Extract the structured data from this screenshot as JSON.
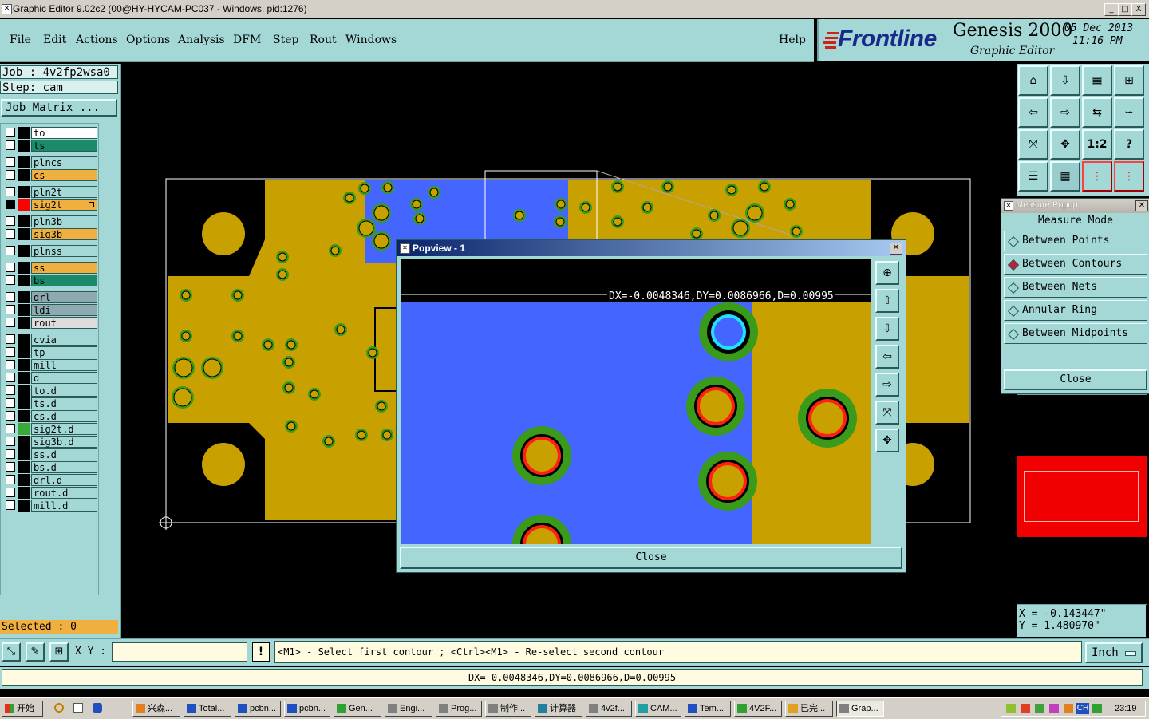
{
  "window": {
    "title": "Graphic Editor 9.02c2 (00@HY-HYCAM-PC037 - Windows, pid:1276)",
    "controls": [
      "_",
      "□",
      "X"
    ]
  },
  "menu": {
    "items": [
      "File",
      "Edit",
      "Actions",
      "Options",
      "Analysis",
      "DFM",
      "Step",
      "Rout",
      "Windows"
    ],
    "help": "Help"
  },
  "brand": {
    "logo": "Frontline",
    "product": "Genesis 2000",
    "subtitle": "Graphic Editor",
    "date": "05 Dec 2013",
    "time": "11:16 PM"
  },
  "job": {
    "job_label": "Job : 4v2fp2wsa0",
    "step_label": "Step: cam",
    "matrix_button": "Job Matrix ..."
  },
  "layers": [
    {
      "name": "to",
      "bg": "#ffffff",
      "swatch": "#000000"
    },
    {
      "name": "ts",
      "bg": "#1a8a6a",
      "swatch": "#000000"
    },
    {
      "name": "plncs",
      "bg": "#a4d8d6",
      "swatch": "#000000"
    },
    {
      "name": "cs",
      "bg": "#f0b040",
      "swatch": "#000000"
    },
    {
      "name": "pln2t",
      "bg": "#a4d8d6",
      "swatch": "#000000"
    },
    {
      "name": "sig2t",
      "bg": "#f0b040",
      "swatch": "#ff0000",
      "active": true
    },
    {
      "name": "pln3b",
      "bg": "#a4d8d6",
      "swatch": "#000000"
    },
    {
      "name": "sig3b",
      "bg": "#f0b040",
      "swatch": "#000000"
    },
    {
      "name": "plnss",
      "bg": "#a4d8d6",
      "swatch": "#000000"
    },
    {
      "name": "ss",
      "bg": "#f0b040",
      "swatch": "#000000"
    },
    {
      "name": "bs",
      "bg": "#1a8a6a",
      "swatch": "#000000"
    },
    {
      "name": "drl",
      "bg": "#8eaab0",
      "swatch": "#000000"
    },
    {
      "name": "ldi",
      "bg": "#8eaab0",
      "swatch": "#000000"
    },
    {
      "name": "rout",
      "bg": "#dcdcdc",
      "swatch": "#000000"
    },
    {
      "name": "cvia",
      "bg": "#a4d8d6",
      "swatch": "#000000"
    },
    {
      "name": "tp",
      "bg": "#a4d8d6",
      "swatch": "#000000"
    },
    {
      "name": "mill",
      "bg": "#a4d8d6",
      "swatch": "#000000"
    },
    {
      "name": "d",
      "bg": "#a4d8d6",
      "swatch": "#000000"
    },
    {
      "name": "to.d",
      "bg": "#a4d8d6",
      "swatch": "#000000"
    },
    {
      "name": "ts.d",
      "bg": "#a4d8d6",
      "swatch": "#000000"
    },
    {
      "name": "cs.d",
      "bg": "#a4d8d6",
      "swatch": "#000000"
    },
    {
      "name": "sig2t.d",
      "bg": "#a4d8d6",
      "swatch": "#3aa83a"
    },
    {
      "name": "sig3b.d",
      "bg": "#a4d8d6",
      "swatch": "#000000"
    },
    {
      "name": "ss.d",
      "bg": "#a4d8d6",
      "swatch": "#000000"
    },
    {
      "name": "bs.d",
      "bg": "#a4d8d6",
      "swatch": "#000000"
    },
    {
      "name": "drl.d",
      "bg": "#a4d8d6",
      "swatch": "#000000"
    },
    {
      "name": "rout.d",
      "bg": "#a4d8d6",
      "swatch": "#000000"
    },
    {
      "name": "mill.d",
      "bg": "#a4d8d6",
      "swatch": "#000000"
    }
  ],
  "selected": "Selected : 0",
  "toolbar": {
    "icons": [
      "home-icon",
      "down-icon",
      "building-icon",
      "grid-xy-icon",
      "left-icon",
      "right-icon",
      "swap-icon",
      "snake-icon",
      "fit-icon",
      "center-icon",
      "ratio-label",
      "help-icon",
      "snap-icon",
      "grid-icon",
      "net-red-icon",
      "net-red-icon-2"
    ],
    "ratio": "1:2",
    "help": "?"
  },
  "measure": {
    "title": "Measure Popup",
    "mode_label": "Measure Mode",
    "options": [
      "Between Points",
      "Between Contours",
      "Between Nets",
      "Annular Ring",
      "Between Midpoints"
    ],
    "selected_index": 1,
    "close": "Close"
  },
  "popview": {
    "title": "Popview - 1",
    "measurement": "DX=-0.0048346,DY=0.0086966,D=0.00995",
    "close": "Close"
  },
  "coords": {
    "x": "X = -0.143447\"",
    "y": "Y = 1.480970\""
  },
  "command": {
    "xy_label": "X Y :",
    "xy_value": "",
    "warn": "!",
    "prompt": "<M1> - Select first contour ; <Ctrl><M1> - Re-select second contour",
    "units": "Inch"
  },
  "status": "DX=-0.0048346,DY=0.0086966,D=0.00995",
  "taskbar": {
    "start": "开始",
    "tasks": [
      "兴森...",
      "Total...",
      "pcbn...",
      "pcbn...",
      "Gen...",
      "Engi...",
      "Prog...",
      "制作...",
      "计算器",
      "4v2f...",
      "CAM...",
      "Tem...",
      "4V2F...",
      "已完...",
      "Grap..."
    ],
    "ime": "CH",
    "clock": "23:19"
  },
  "colors": {
    "panel": "#a4d8d6",
    "copper": "#c8a000",
    "plane": "#4466ff",
    "pad_ring": "#3a9a1a"
  }
}
